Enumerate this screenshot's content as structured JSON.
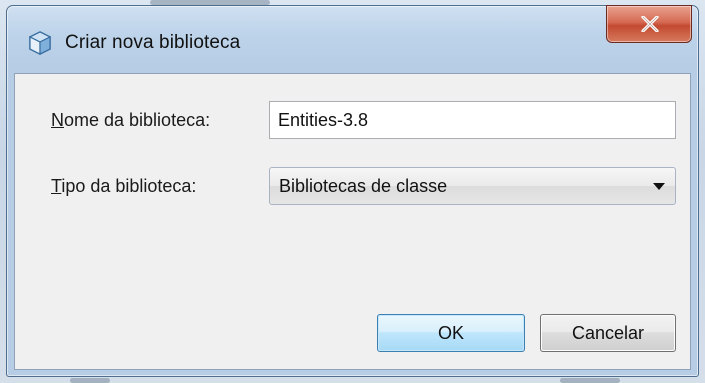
{
  "window": {
    "title": "Criar nova biblioteca",
    "icon": "netbeans-cube-icon",
    "close_icon": "close-x-icon"
  },
  "form": {
    "name_label_mnemonic": "N",
    "name_label_rest": "ome da biblioteca:",
    "name_value": "Entities-3.8",
    "type_label_mnemonic": "T",
    "type_label_rest": "ipo da biblioteca:",
    "type_selected": "Bibliotecas de classe"
  },
  "buttons": {
    "ok_label": "OK",
    "cancel_label": "Cancelar"
  },
  "colors": {
    "title_bar": "#bdd3ea",
    "close_button": "#c24a31",
    "default_button_border": "#3c7fb1",
    "client_background": "#f0f0f0"
  }
}
